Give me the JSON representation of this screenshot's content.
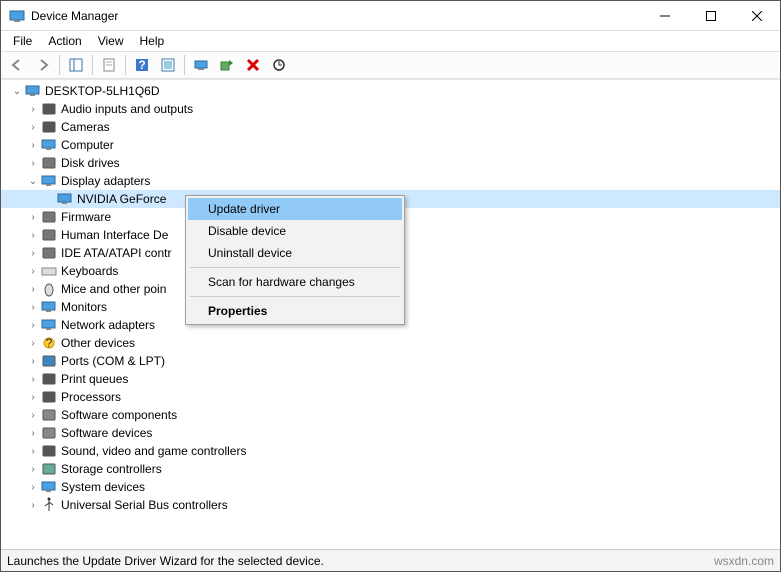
{
  "window": {
    "title": "Device Manager"
  },
  "menu": {
    "file": "File",
    "action": "Action",
    "view": "View",
    "help": "Help"
  },
  "toolbar_icons": [
    "back",
    "forward",
    "show-hide",
    "properties",
    "help",
    "refresh",
    "monitor",
    "install",
    "delete",
    "scan"
  ],
  "tree": {
    "root": "DESKTOP-5LH1Q6D",
    "categories": [
      {
        "label": "Audio inputs and outputs",
        "icon": "audio"
      },
      {
        "label": "Cameras",
        "icon": "camera"
      },
      {
        "label": "Computer",
        "icon": "computer"
      },
      {
        "label": "Disk drives",
        "icon": "disk"
      },
      {
        "label": "Display adapters",
        "icon": "display",
        "expanded": true,
        "children": [
          {
            "label": "NVIDIA GeForce",
            "icon": "display",
            "selected": true
          }
        ]
      },
      {
        "label": "Firmware",
        "icon": "firmware"
      },
      {
        "label": "Human Interface De",
        "icon": "hid"
      },
      {
        "label": "IDE ATA/ATAPI contr",
        "icon": "ide"
      },
      {
        "label": "Keyboards",
        "icon": "keyboard"
      },
      {
        "label": "Mice and other poin",
        "icon": "mouse"
      },
      {
        "label": "Monitors",
        "icon": "monitor"
      },
      {
        "label": "Network adapters",
        "icon": "network"
      },
      {
        "label": "Other devices",
        "icon": "other"
      },
      {
        "label": "Ports (COM & LPT)",
        "icon": "port"
      },
      {
        "label": "Print queues",
        "icon": "printer"
      },
      {
        "label": "Processors",
        "icon": "cpu"
      },
      {
        "label": "Software components",
        "icon": "softcomp"
      },
      {
        "label": "Software devices",
        "icon": "softdev"
      },
      {
        "label": "Sound, video and game controllers",
        "icon": "sound"
      },
      {
        "label": "Storage controllers",
        "icon": "storage"
      },
      {
        "label": "System devices",
        "icon": "system"
      },
      {
        "label": "Universal Serial Bus controllers",
        "icon": "usb"
      }
    ]
  },
  "context_menu": {
    "items": [
      {
        "label": "Update driver",
        "highlight": true
      },
      {
        "label": "Disable device"
      },
      {
        "label": "Uninstall device"
      },
      {
        "sep": true
      },
      {
        "label": "Scan for hardware changes"
      },
      {
        "sep": true
      },
      {
        "label": "Properties",
        "bold": true
      }
    ]
  },
  "status": {
    "text": "Launches the Update Driver Wizard for the selected device.",
    "source": "wsxdn.com"
  }
}
